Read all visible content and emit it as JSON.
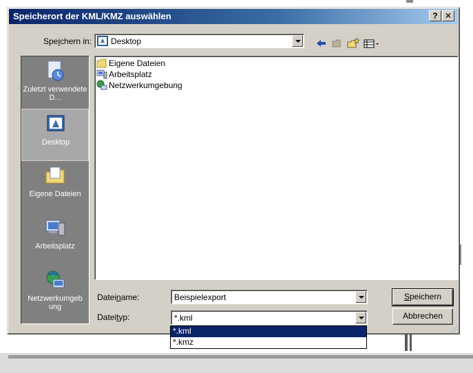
{
  "dialog": {
    "title": "Speicherort der KML/KMZ auswählen",
    "help_button": "?",
    "close_button": "✕"
  },
  "save_in": {
    "label_pre": "Spe",
    "label_accel": "i",
    "label_post": "chern in:",
    "value": "Desktop"
  },
  "toolbar": {
    "icons": [
      "back-arrow-icon",
      "up-folder-icon",
      "new-folder-icon",
      "view-menu-icon"
    ]
  },
  "places": [
    {
      "label": "Zuletzt verwendete D...",
      "icon": "recent-documents-icon"
    },
    {
      "label": "Desktop",
      "icon": "desktop-icon",
      "selected": true
    },
    {
      "label": "Eigene Dateien",
      "icon": "my-documents-icon"
    },
    {
      "label": "Arbeitsplatz",
      "icon": "my-computer-icon"
    },
    {
      "label": "Netzwerkumgeb ung",
      "icon": "network-places-icon"
    }
  ],
  "files": [
    {
      "label": "Eigene Dateien",
      "icon": "folder-icon"
    },
    {
      "label": "Arbeitsplatz",
      "icon": "computer-icon"
    },
    {
      "label": "Netzwerkumgebung",
      "icon": "network-icon"
    }
  ],
  "filename": {
    "label_pre": "Datei",
    "label_accel": "n",
    "label_post": "ame:",
    "value": "Beispielexport"
  },
  "filetype": {
    "label_pre": "Datei",
    "label_accel": "t",
    "label_post": "yp:",
    "value": "*.kml",
    "options": [
      "*.kml",
      "*.kmz"
    ],
    "selected_index": 0
  },
  "buttons": {
    "save_accel": "S",
    "save_rest": "peichern",
    "cancel": "Abbrechen"
  },
  "colors": {
    "title_bar_start": "#0a246a",
    "title_bar_end": "#a6caf0",
    "dialog_face": "#d4d0c8",
    "places_bar": "#808080",
    "selection": "#0a246a"
  }
}
